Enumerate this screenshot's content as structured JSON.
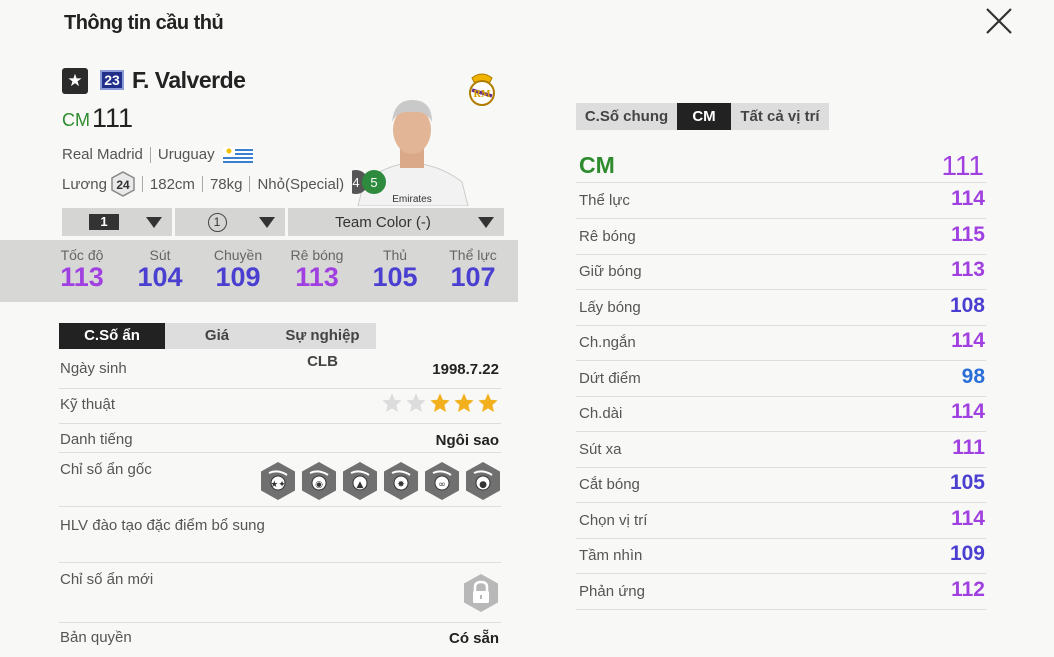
{
  "header": {
    "title": "Thông tin cầu thủ",
    "close_icon": "close-icon"
  },
  "player": {
    "shirt_number": "23",
    "name": "F. Valverde",
    "position": "CM",
    "overall": "111",
    "club": "Real Madrid",
    "nation": "Uruguay",
    "salary_label": "Lương",
    "salary": "24",
    "height": "182cm",
    "weight": "78kg",
    "body_type": "Nhỏ(Special)",
    "weak_foot_left": "4",
    "weak_foot_right": "5"
  },
  "selectors": {
    "upgrade_level": "1",
    "training_level": "1",
    "team_color": "Team Color (-)"
  },
  "summary_stats": [
    {
      "label": "Tốc độ",
      "value": "113",
      "color": "#a040e0"
    },
    {
      "label": "Sút",
      "value": "104",
      "color": "#4a3fd0"
    },
    {
      "label": "Chuyền",
      "value": "109",
      "color": "#4a3fd0"
    },
    {
      "label": "Rê bóng",
      "value": "113",
      "color": "#a040e0"
    },
    {
      "label": "Thủ",
      "value": "105",
      "color": "#4a3fd0"
    },
    {
      "label": "Thể lực",
      "value": "107",
      "color": "#4a3fd0"
    }
  ],
  "left_tabs": [
    {
      "label": "C.Số ẩn",
      "active": true
    },
    {
      "label": "Giá",
      "active": false
    },
    {
      "label": "Sự nghiệp CLB",
      "active": false
    }
  ],
  "details": {
    "birth_label": "Ngày sinh",
    "birth_value": "1998.7.22",
    "skill_label": "Kỹ thuật",
    "skill_stars": 5,
    "skill_stars_filled": 3,
    "fame_label": "Danh tiếng",
    "fame_value": "Ngôi sao",
    "traits_label": "Chỉ số ẩn gốc",
    "traits_icons": [
      "speed-dribbler-trait-icon",
      "finesse-shot-trait-icon",
      "long-passer-trait-icon",
      "flair-trait-icon",
      "playmaker-trait-icon",
      "long-shot-trait-icon"
    ],
    "coach_label": "HLV đào tạo đặc điểm bổ sung",
    "new_traits_label": "Chỉ số ẩn mới",
    "license_label": "Bản quyền",
    "license_value": "Có sẵn"
  },
  "right_tabs": [
    {
      "label": "C.Số chung",
      "active": false
    },
    {
      "label": "CM",
      "active": true
    },
    {
      "label": "Tất cả vị trí",
      "active": false
    }
  ],
  "position_rating": {
    "position": "CM",
    "value": "111"
  },
  "attributes": [
    {
      "label": "Thể lực",
      "value": "114",
      "color": "#a040e0"
    },
    {
      "label": "Rê bóng",
      "value": "115",
      "color": "#a040e0"
    },
    {
      "label": "Giữ bóng",
      "value": "113",
      "color": "#a040e0"
    },
    {
      "label": "Lấy bóng",
      "value": "108",
      "color": "#4a3fd0"
    },
    {
      "label": "Ch.ngắn",
      "value": "114",
      "color": "#a040e0"
    },
    {
      "label": "Dứt điểm",
      "value": "98",
      "color": "#2a6fd8"
    },
    {
      "label": "Ch.dài",
      "value": "114",
      "color": "#a040e0"
    },
    {
      "label": "Sút xa",
      "value": "111",
      "color": "#a040e0"
    },
    {
      "label": "Cắt bóng",
      "value": "105",
      "color": "#4a3fd0"
    },
    {
      "label": "Chọn vị trí",
      "value": "114",
      "color": "#a040e0"
    },
    {
      "label": "Tầm nhìn",
      "value": "109",
      "color": "#4a3fd0"
    },
    {
      "label": "Phản ứng",
      "value": "112",
      "color": "#a040e0"
    }
  ]
}
